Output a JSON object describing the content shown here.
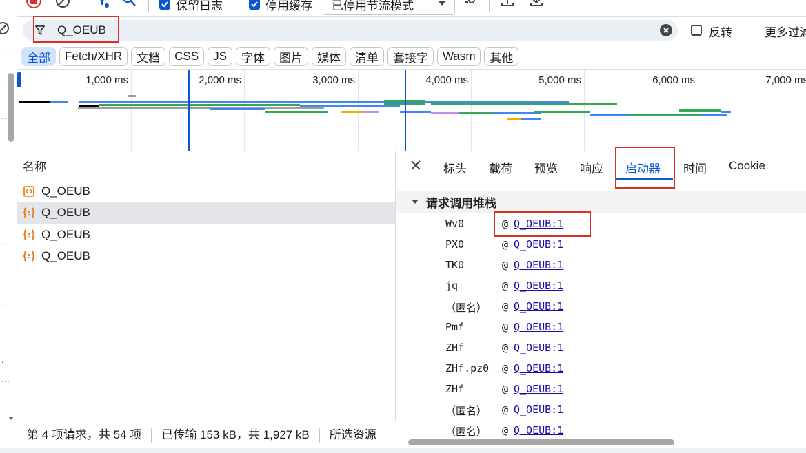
{
  "toolbar": {
    "preserve_log_label": "保留日志",
    "disable_cache_label": "停用缓存",
    "throttle_value": "已停用节流模式"
  },
  "filter": {
    "value": "Q_OEUB",
    "invert_label": "反转",
    "more_filters_label": "更多过滤"
  },
  "type_chips": [
    "全部",
    "Fetch/XHR",
    "文档",
    "CSS",
    "JS",
    "字体",
    "图片",
    "媒体",
    "清单",
    "套接字",
    "Wasm",
    "其他"
  ],
  "overview": {
    "ticks": [
      "1,000 ms",
      "2,000 ms",
      "3,000 ms",
      "4,000 ms",
      "5,000 ms",
      "6,000 ms",
      "7,000 ms"
    ]
  },
  "list": {
    "header": "名称",
    "rows": [
      {
        "name": "Q_OEUB",
        "icon": "document-icon"
      },
      {
        "name": "Q_OEUB",
        "icon": "script-icon"
      },
      {
        "name": "Q_OEUB",
        "icon": "script-icon"
      },
      {
        "name": "Q_OEUB",
        "icon": "script-icon"
      }
    ]
  },
  "statusbar": {
    "requests": "第 4 项请求，共 54 项",
    "transferred": "已传输 153 kB，共 1,927 kB",
    "selected": "所选资源"
  },
  "details": {
    "tabs": [
      "标头",
      "载荷",
      "预览",
      "响应",
      "启动器",
      "时间",
      "Cookie"
    ],
    "active_tab": "启动器",
    "section_title": "请求调用堆栈",
    "stack": [
      {
        "fn": "Wv0",
        "loc": "Q_OEUB:1"
      },
      {
        "fn": "PX0",
        "loc": "Q_OEUB:1"
      },
      {
        "fn": "TK0",
        "loc": "Q_OEUB:1"
      },
      {
        "fn": "jq",
        "loc": "Q_OEUB:1"
      },
      {
        "fn": "（匿名）",
        "loc": "Q_OEUB:1"
      },
      {
        "fn": "Pmf",
        "loc": "Q_OEUB:1"
      },
      {
        "fn": "ZHf",
        "loc": "Q_OEUB:1"
      },
      {
        "fn": "ZHf.pz0",
        "loc": "Q_OEUB:1"
      },
      {
        "fn": "ZHf",
        "loc": "Q_OEUB:1"
      },
      {
        "fn": "（匿名）",
        "loc": "Q_OEUB:1"
      },
      {
        "fn": "（匿名）",
        "loc": "Q_OEUB:1"
      }
    ],
    "at_symbol": "@"
  },
  "colors": {
    "accent": "#0b57d0",
    "highlight": "#d93025",
    "selected_row": "#e3e5e8"
  }
}
